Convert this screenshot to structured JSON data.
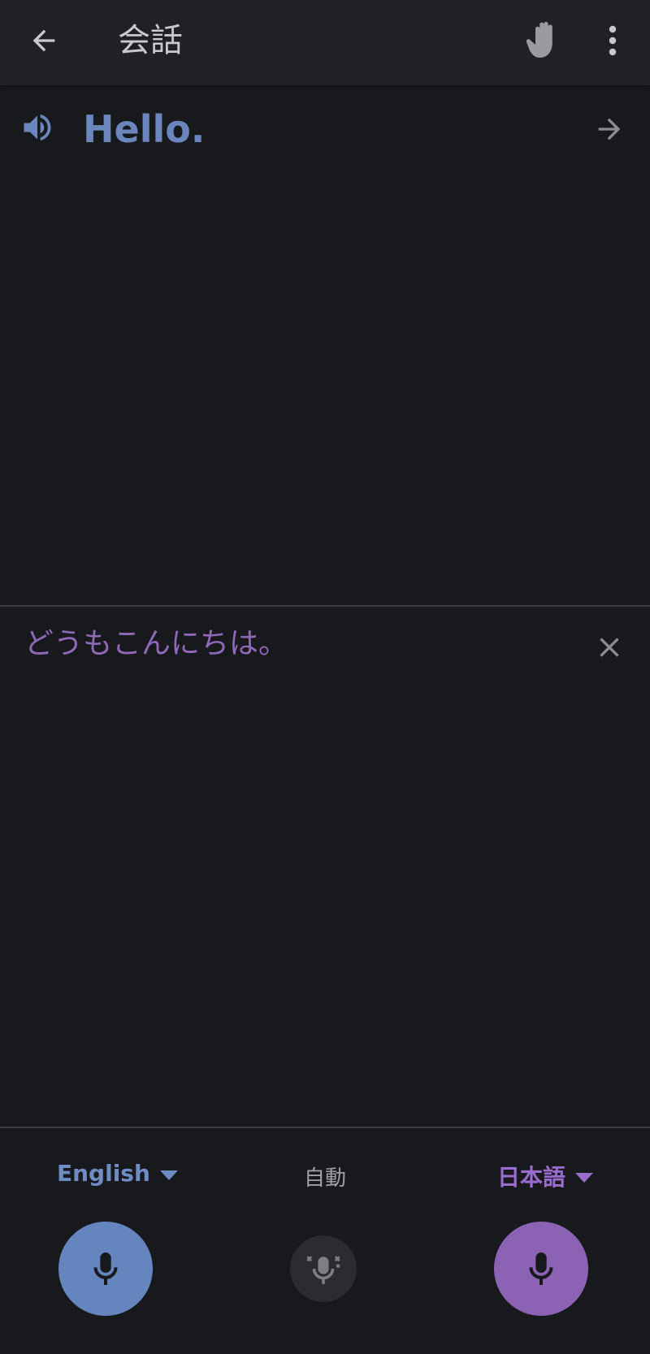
{
  "header": {
    "title": "会話",
    "icons": {
      "back": "arrow-left-icon",
      "hand": "hand-icon",
      "more": "more-vertical-icon"
    }
  },
  "source": {
    "text": "Hello.",
    "icons": {
      "speaker": "speaker-icon",
      "forward": "arrow-right-icon"
    }
  },
  "target": {
    "text": "どうもこんにちは。",
    "icons": {
      "close": "close-icon"
    }
  },
  "bottom": {
    "left_language": "English",
    "auto_label": "自動",
    "right_language": "日本語"
  },
  "colors": {
    "background": "#18191c",
    "topbar": "#202124",
    "source_accent": "#6b86bd",
    "target_accent": "#9068b8",
    "left_mic": "#6585bf",
    "right_mic": "#8b62b4",
    "auto_mic": "#2b2c2f"
  }
}
